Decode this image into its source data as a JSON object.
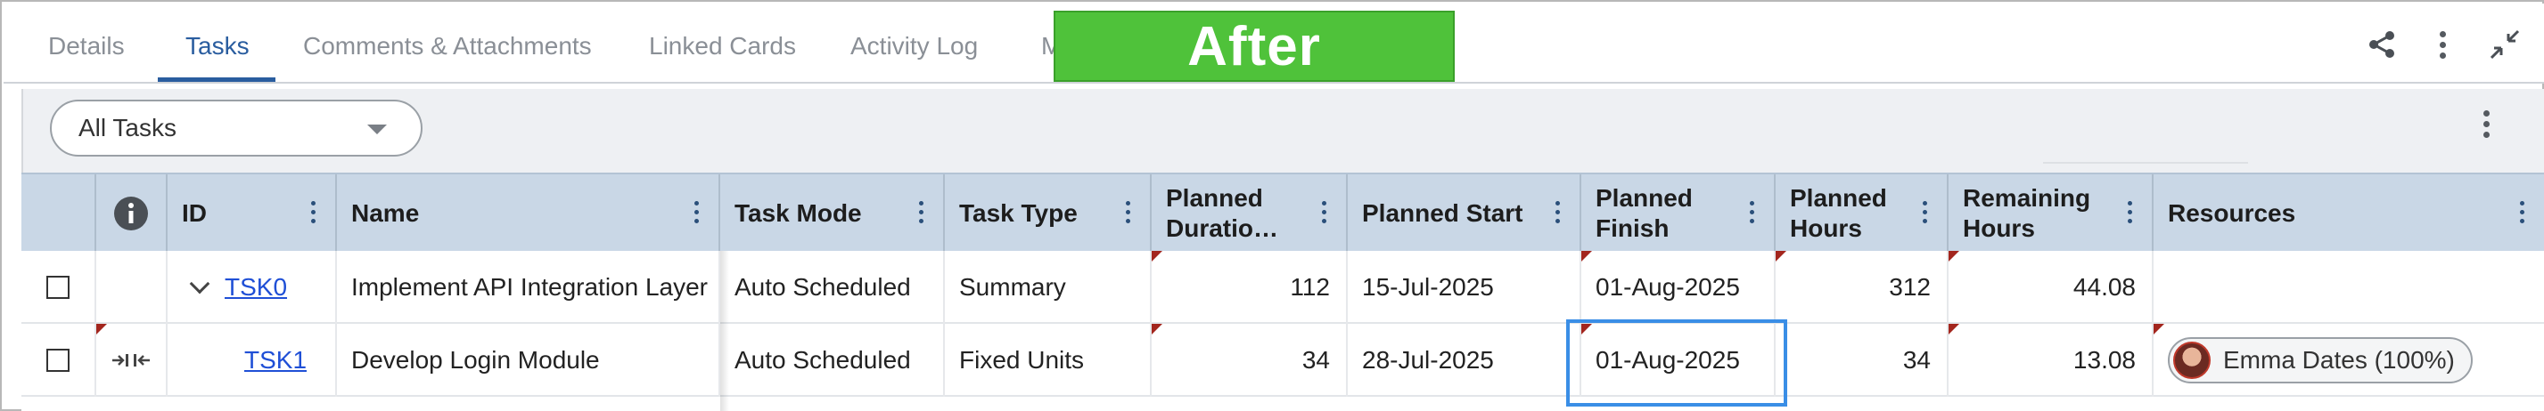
{
  "tabs": [
    {
      "label": "Details",
      "active": false
    },
    {
      "label": "Tasks",
      "active": true
    },
    {
      "label": "Comments & Attachments",
      "active": false
    },
    {
      "label": "Linked Cards",
      "active": false
    },
    {
      "label": "Activity Log",
      "active": false
    },
    {
      "label": "M",
      "active": false
    }
  ],
  "banner": {
    "text": "After",
    "color": "#4fc23a"
  },
  "header_icons": [
    "share-icon",
    "kebab-menu-icon",
    "collapse-icon"
  ],
  "filter": {
    "selected": "All Tasks"
  },
  "columns": [
    {
      "label": ""
    },
    {
      "label": "info-icon"
    },
    {
      "label": "ID"
    },
    {
      "label": "Name"
    },
    {
      "label": "Task Mode"
    },
    {
      "label": "Task Type"
    },
    {
      "label": "Planned Duratio…"
    },
    {
      "label": "Planned Start"
    },
    {
      "label": "Planned Finish"
    },
    {
      "label": "Planned Hours"
    },
    {
      "label": "Remaining Hours"
    },
    {
      "label": "Resources"
    }
  ],
  "rows": [
    {
      "id": "TSK0",
      "name": "Implement API Integration Layer",
      "task_mode": "Auto Scheduled",
      "task_type": "Summary",
      "planned_duration": "112",
      "planned_start": "15-Jul-2025",
      "planned_finish": "01-Aug-2025",
      "planned_hours": "312",
      "remaining_hours": "44.08",
      "resources": ""
    },
    {
      "id": "TSK1",
      "name": "Develop Login Module",
      "task_mode": "Auto Scheduled",
      "task_type": "Fixed Units",
      "planned_duration": "34",
      "planned_start": "28-Jul-2025",
      "planned_finish": "01-Aug-2025",
      "planned_hours": "34",
      "remaining_hours": "13.08",
      "resources": "Emma Dates (100%)"
    }
  ],
  "colors": {
    "accent": "#2a5d9f",
    "header_bg": "#c9d7e6",
    "selection": "#3a8ee6",
    "change_marker": "#a3261e"
  }
}
